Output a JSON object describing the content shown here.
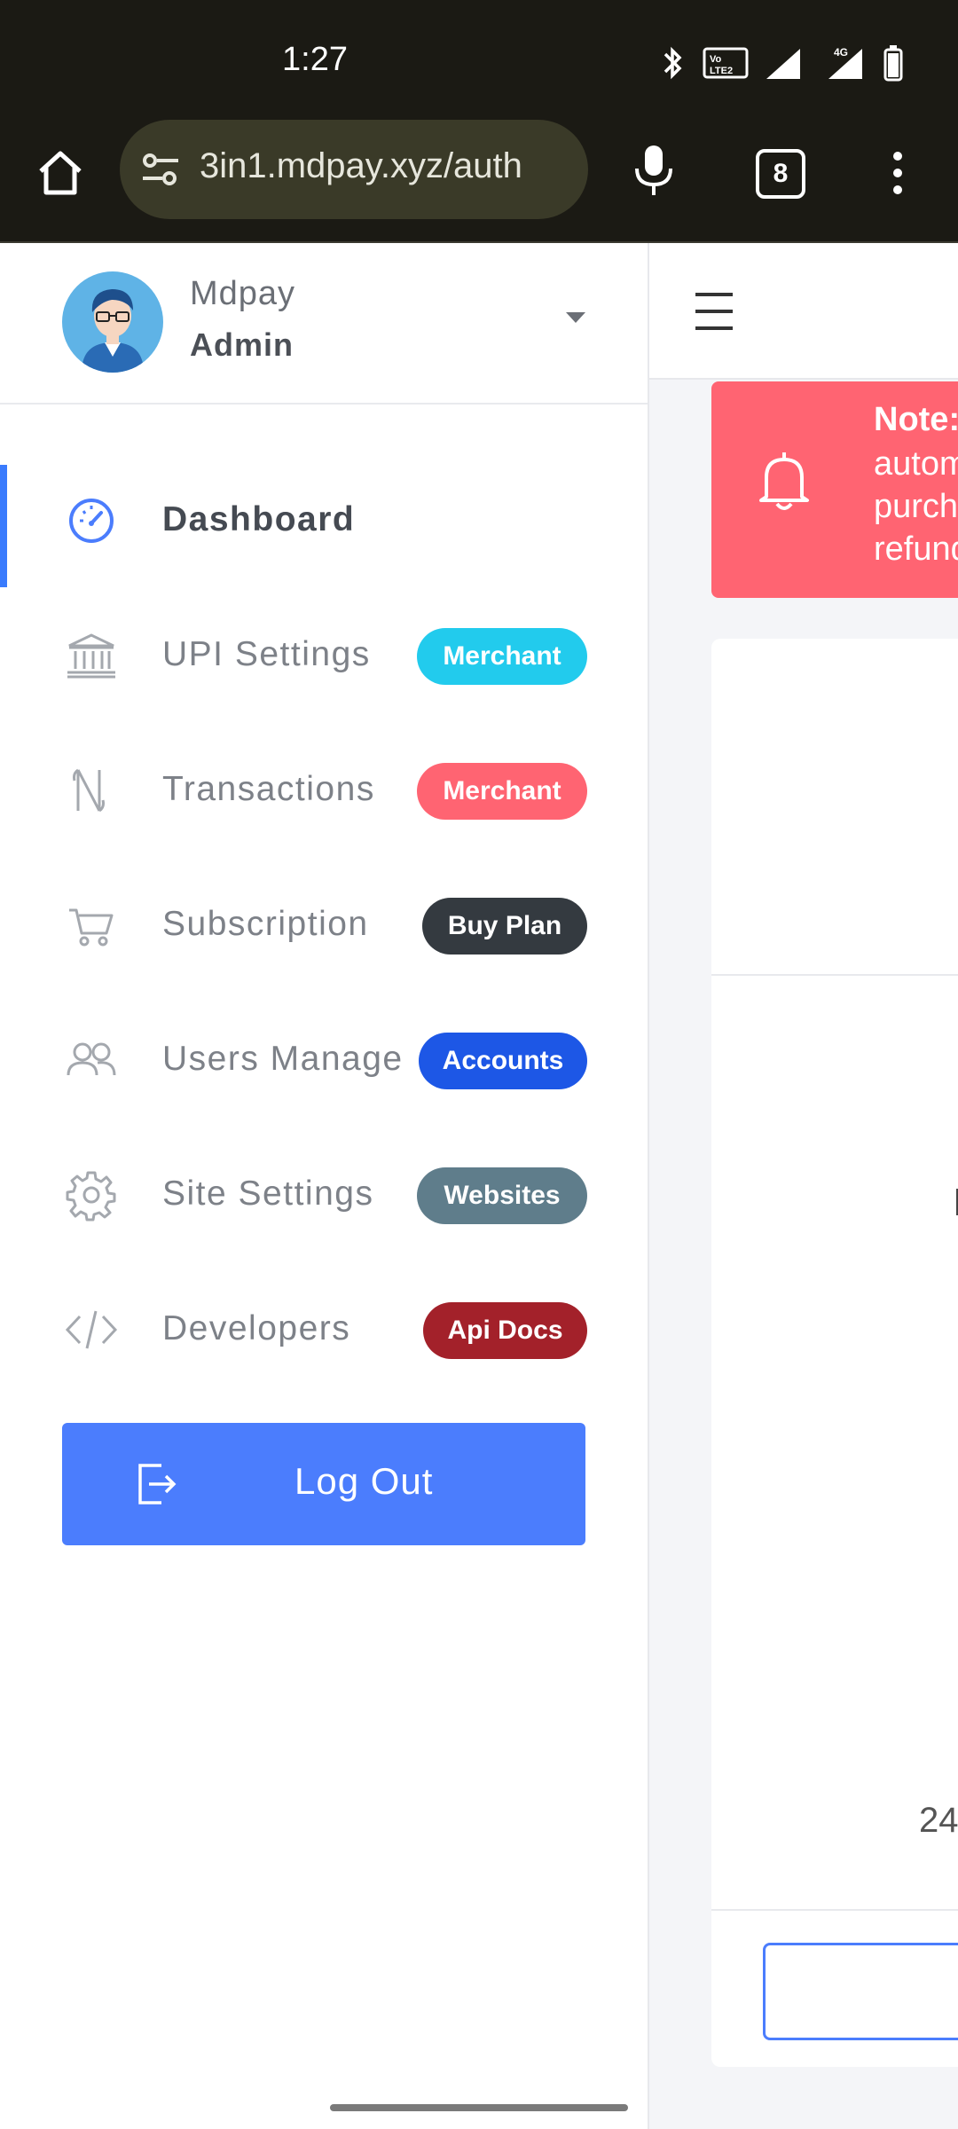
{
  "status_bar": {
    "time": "1:27",
    "tabs_count": "8"
  },
  "browser": {
    "url": "3in1.mdpay.xyz/auth"
  },
  "profile": {
    "name": "Mdpay",
    "role": "Admin"
  },
  "nav": [
    {
      "label": "Dashboard",
      "icon": "speedometer-icon",
      "active": true
    },
    {
      "label": "UPI Settings",
      "icon": "bank-icon",
      "badge": "Merchant",
      "badge_color": "#22cbed"
    },
    {
      "label": "Transactions",
      "icon": "rupee-icon",
      "badge": "Merchant",
      "badge_color": "#ff6472"
    },
    {
      "label": "Subscription",
      "icon": "cart-icon",
      "badge": "Buy Plan",
      "badge_color": "#343a40"
    },
    {
      "label": "Users Manage",
      "icon": "users-icon",
      "badge": "Accounts",
      "badge_color": "#1d57e6"
    },
    {
      "label": "Site Settings",
      "icon": "gear-icon",
      "badge": "Websites",
      "badge_color": "#5f7d8b"
    },
    {
      "label": "Developers",
      "icon": "code-icon",
      "badge": "Api Docs",
      "badge_color": "#a3212a"
    }
  ],
  "logout": {
    "label": "Log Out"
  },
  "alert": {
    "title": "Note:",
    "lines": [
      "autom",
      "purch",
      "refund"
    ]
  },
  "card": {
    "number": "24"
  },
  "colors": {
    "accent": "#4b7dfd",
    "alert": "#ff6472"
  }
}
